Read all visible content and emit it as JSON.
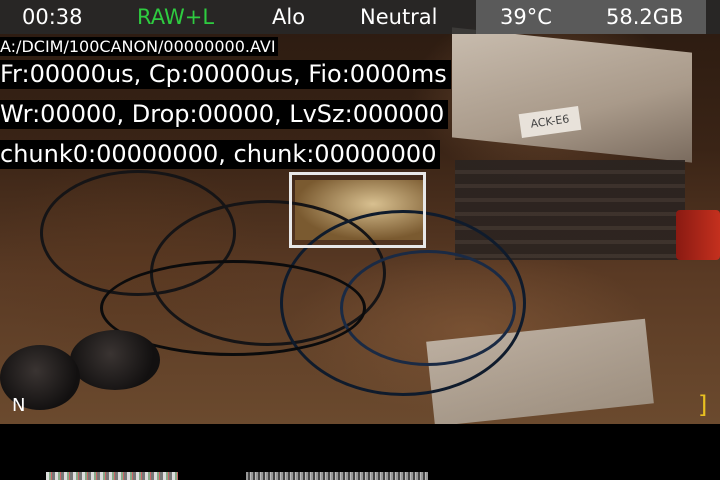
{
  "status_bar": {
    "recording_time": "00:38",
    "format": "RAW+L",
    "format_color": "#2ecc40",
    "picture_style_mode": "Alo",
    "picture_style": "Neutral",
    "temperature": "39°C",
    "card_space": "58.2GB"
  },
  "overlay": {
    "file_path": "A:/DCIM/100CANON/00000000.AVI",
    "timing_line": "Fr:00000us, Cp:00000us, Fio:0000ms",
    "write_line": "Wr:00000, Drop:00000, LvSz:000000",
    "chunk_line": "chunk0:00000000, chunk:00000000"
  },
  "liveview": {
    "box_label": "ACK-E6"
  },
  "markers": {
    "bottom_left": "N",
    "bottom_right": "]"
  },
  "colors": {
    "bar_background": "#282828",
    "accent_green": "#2ecc40",
    "marker_yellow": "#e8c020"
  }
}
